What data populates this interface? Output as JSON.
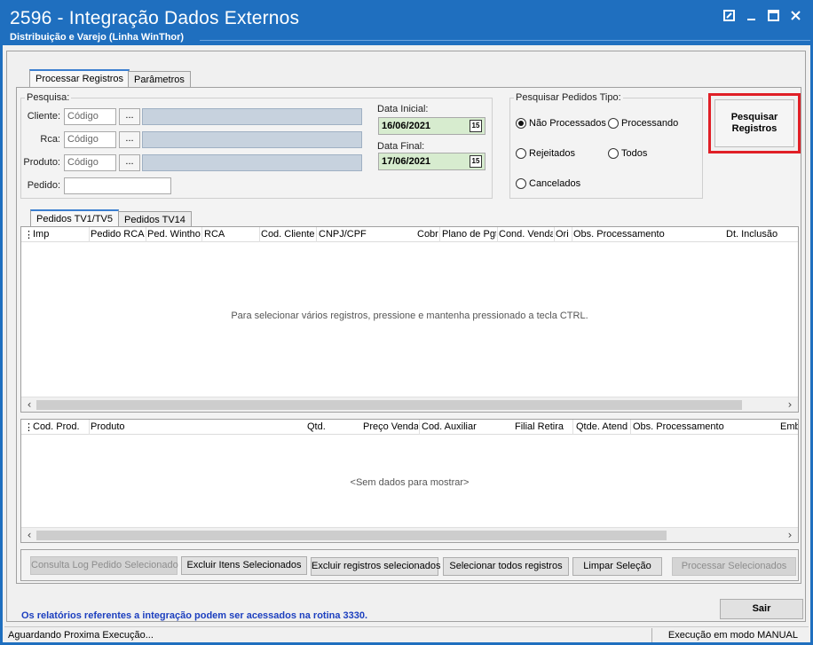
{
  "window": {
    "title": "2596 - Integração Dados Externos",
    "subtitle": "Distribuição e Varejo (Linha WinThor)",
    "controls": [
      "restore-icon",
      "minimize-icon",
      "maximize-icon",
      "close-icon"
    ]
  },
  "tabs_top": [
    {
      "label": "Processar Registros",
      "active": true
    },
    {
      "label": "Parâmetros",
      "active": false
    }
  ],
  "search": {
    "group_title": "Pesquisa:",
    "cliente_label": "Cliente:",
    "cliente_placeholder": "Código",
    "rca_label": "Rca:",
    "rca_placeholder": "Código",
    "produto_label": "Produto:",
    "produto_placeholder": "Código",
    "pedido_label": "Pedido:",
    "pedido_value": "",
    "dots": "...",
    "data_inicial_label": "Data Inicial:",
    "data_inicial_value": "16/06/2021",
    "data_final_label": "Data Final:",
    "data_final_value": "17/06/2021",
    "calendar_glyph": "15"
  },
  "pedidos_tipo": {
    "group_title": "Pesquisar Pedidos Tipo:",
    "options": [
      {
        "label": "Não Processados",
        "selected": true
      },
      {
        "label": "Processando",
        "selected": false
      },
      {
        "label": "Rejeitados",
        "selected": false
      },
      {
        "label": "Todos",
        "selected": false
      },
      {
        "label": "Cancelados",
        "selected": false
      }
    ]
  },
  "pesquisar_button": {
    "line1": "Pesquisar",
    "line2": "Registros"
  },
  "tabs_grid": [
    {
      "label": "Pedidos TV1/TV5",
      "active": true
    },
    {
      "label": "Pedidos TV14",
      "active": false
    }
  ],
  "grid_pedidos": {
    "columns": [
      "Imp",
      "Pedido RCA",
      "Ped. Wintho",
      "RCA",
      "Cod. Cliente",
      "CNPJ/CPF",
      "Cobr",
      "Plano de Pgt",
      "Cond. Venda",
      "Ori",
      "Obs. Processamento",
      "Dt. Inclusão"
    ],
    "message": "Para selecionar vários registros, pressione e mantenha pressionado a tecla CTRL."
  },
  "grid_itens": {
    "columns": [
      "Cod. Prod.",
      "Produto",
      "Qtd.",
      "Preço Venda",
      "Cod. Auxiliar",
      "Filial Retira",
      "Qtde. Atend",
      "Obs. Processamento",
      "Emb."
    ],
    "message": "<Sem dados para mostrar>"
  },
  "action_buttons": [
    {
      "label": "Consulta Log Pedido Selecionado",
      "enabled": false
    },
    {
      "label": "Excluir Itens Selecionados",
      "enabled": true
    },
    {
      "label": "Excluir registros selecionados",
      "enabled": true
    },
    {
      "label": "Selecionar todos registros",
      "enabled": true
    },
    {
      "label": "Limpar Seleção",
      "enabled": true
    },
    {
      "label": "Processar Selecionados",
      "enabled": false
    }
  ],
  "info_text": "Os relatórios referentes a integração podem ser acessados na rotina 3330.",
  "sair_label": "Sair",
  "status": {
    "left": "Aguardando Proxima Execução...",
    "right": "Execução em modo MANUAL"
  },
  "colors": {
    "titlebar": "#1f6fbf",
    "highlight_border": "#e01f26",
    "date_bg": "#d7eccf",
    "info_text": "#1c3fbf"
  }
}
